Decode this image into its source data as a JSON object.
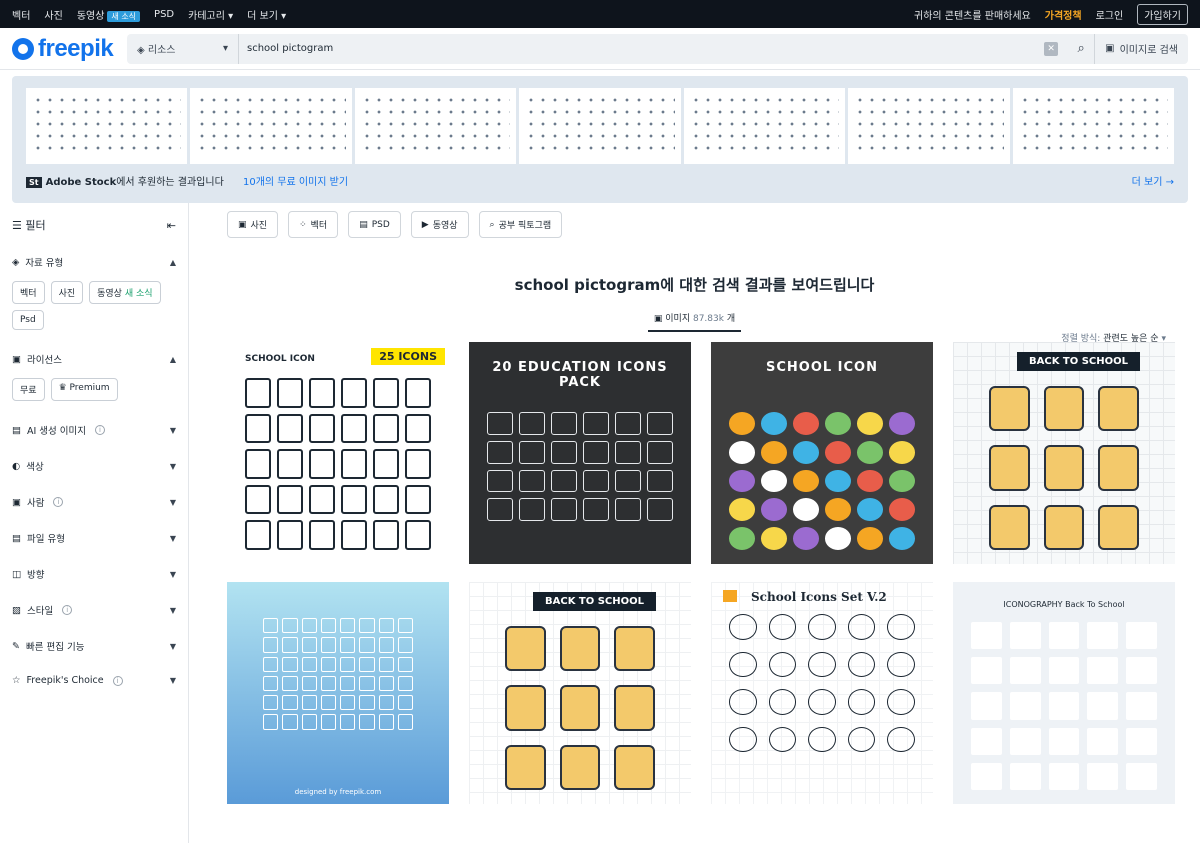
{
  "topnav": {
    "links": [
      "벡터",
      "사진",
      "동영상",
      "PSD",
      "카테고리",
      "더 보기"
    ],
    "video_badge": "새 소식",
    "sell": "귀하의 콘텐츠를 판매하세요",
    "pricing": "가격정책",
    "login": "로그인",
    "join": "가입하기"
  },
  "header": {
    "logo": "freepik",
    "resource_select": "리소스",
    "search_value": "school pictogram",
    "image_search": "이미지로 검색"
  },
  "stock": {
    "brand": "St",
    "brand_name": "Adobe Stock",
    "sponsored_text": "에서 후원하는 결과입니다",
    "free_offer": "10개의 무료 이미지 받기",
    "more": "더 보기 →"
  },
  "sidebar": {
    "filter": "필터",
    "asset_type": "자료 유형",
    "asset_chips": [
      "벡터",
      "사진",
      "동영상",
      "Psd"
    ],
    "video_new": "새 소식",
    "license": "라이선스",
    "license_chips": [
      "무료",
      "Premium"
    ],
    "sections": [
      "AI 생성 이미지",
      "색상",
      "사람",
      "파일 유형",
      "방향",
      "스타일",
      "빠른 편집 기능",
      "Freepik's Choice"
    ]
  },
  "filters": [
    "사진",
    "벡터",
    "PSD",
    "동영상",
    "공부 픽토그램"
  ],
  "results": {
    "query": "school pictogram",
    "headline_suffix": "에 대한 검색 결과를 보여드립니다",
    "tab_label": "이미지",
    "tab_count": "87.83k",
    "tab_unit": "개",
    "sort_label": "정렬 방식:",
    "sort_value": "관련도 높은 순"
  },
  "cards": [
    {
      "title": "SCHOOL ICON",
      "badge": "25 ICONS"
    },
    {
      "title": "20 EDUCATION ICONS PACK"
    },
    {
      "title": "SCHOOL ICON"
    },
    {
      "title": "BACK TO SCHOOL"
    },
    {
      "footer": "designed by freepik.com"
    },
    {
      "title": "BACK TO SCHOOL"
    },
    {
      "title": "School Icons Set V.2"
    },
    {
      "title": "ICONOGRAPHY Back To School"
    }
  ]
}
